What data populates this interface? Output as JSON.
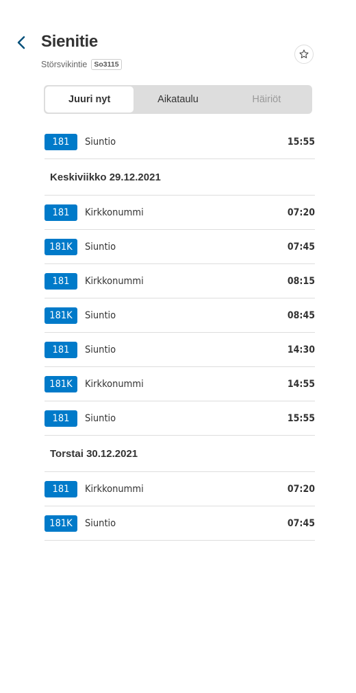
{
  "header": {
    "title": "Sienitie",
    "street": "Störsvikintie",
    "stop_code": "So3115"
  },
  "tabs": [
    {
      "label": "Juuri nyt",
      "state": "active"
    },
    {
      "label": "Aikataulu",
      "state": "normal"
    },
    {
      "label": "Häiriöt",
      "state": "disabled"
    }
  ],
  "colors": {
    "accent": "#007ac9",
    "back_arrow": "#00507a"
  },
  "first_departure": {
    "route": "181",
    "destination": "Siuntio",
    "time": "15:55"
  },
  "days": [
    {
      "label": "Keskiviikko 29.12.2021",
      "departures": [
        {
          "route": "181",
          "destination": "Kirkkonummi",
          "time": "07:20"
        },
        {
          "route": "181K",
          "destination": "Siuntio",
          "time": "07:45"
        },
        {
          "route": "181",
          "destination": "Kirkkonummi",
          "time": "08:15"
        },
        {
          "route": "181K",
          "destination": "Siuntio",
          "time": "08:45"
        },
        {
          "route": "181",
          "destination": "Siuntio",
          "time": "14:30"
        },
        {
          "route": "181K",
          "destination": "Kirkkonummi",
          "time": "14:55"
        },
        {
          "route": "181",
          "destination": "Siuntio",
          "time": "15:55"
        }
      ]
    },
    {
      "label": "Torstai 30.12.2021",
      "departures": [
        {
          "route": "181",
          "destination": "Kirkkonummi",
          "time": "07:20"
        },
        {
          "route": "181K",
          "destination": "Siuntio",
          "time": "07:45"
        }
      ]
    }
  ]
}
